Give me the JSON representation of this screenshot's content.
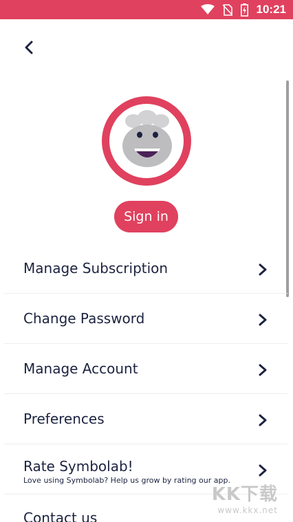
{
  "status_bar": {
    "time": "10:21",
    "color": "#e0415e",
    "icons": [
      "wifi-icon",
      "no-sim-icon",
      "battery-charging-icon"
    ]
  },
  "nav": {
    "back_icon": "chevron-left-icon"
  },
  "profile": {
    "avatar": "chef-mascot-avatar",
    "ring_color": "#e0415e",
    "sign_in_label": "Sign in"
  },
  "menu": {
    "items": [
      {
        "label": "Manage Subscription"
      },
      {
        "label": "Change Password"
      },
      {
        "label": "Manage Account"
      },
      {
        "label": "Preferences"
      },
      {
        "label": "Rate Symbolab!",
        "sub": "Love using Symbolab? Help us grow by rating our app."
      },
      {
        "label": "Contact us"
      }
    ]
  },
  "watermark": {
    "logo": "KK下载",
    "url": "www.kkx.net"
  }
}
